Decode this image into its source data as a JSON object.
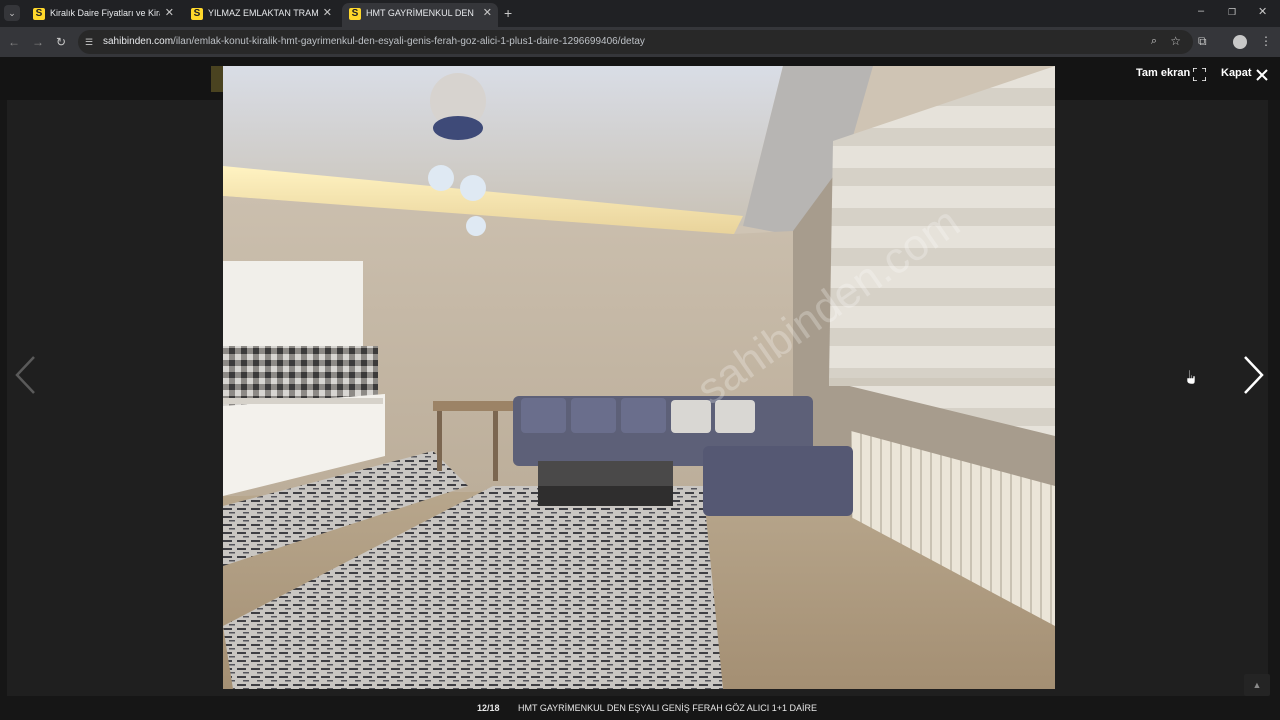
{
  "browser": {
    "tabs": [
      {
        "title": "Kiralık Daire Fiyatları ve Kiralık E"
      },
      {
        "title": "YILMAZ EMLAKTAN TRAMVAY"
      },
      {
        "title": "HMT GAYRİMENKUL DEN EŞYA"
      }
    ],
    "url_host": "sahibinden.com",
    "url_path": "/ilan/emlak-konut-kiralik-hmt-gayrimenkul-den-esyali-genis-ferah-goz-alici-1-plus1-daire-1296699406/detay"
  },
  "lightbox": {
    "listing_id": "#1296699406",
    "fullscreen_label": "Tam ekran",
    "close_label": "Kapat",
    "counter": "12/18",
    "caption": "HMT GAYRİMENKUL DEN EŞYALI GENİŞ FERAH GÖZ ALICI 1+1 DAİRE",
    "watermark": "sahibinden.com"
  },
  "colors": {
    "favicon": "#ffd82b",
    "background": "#1f1f1f"
  }
}
